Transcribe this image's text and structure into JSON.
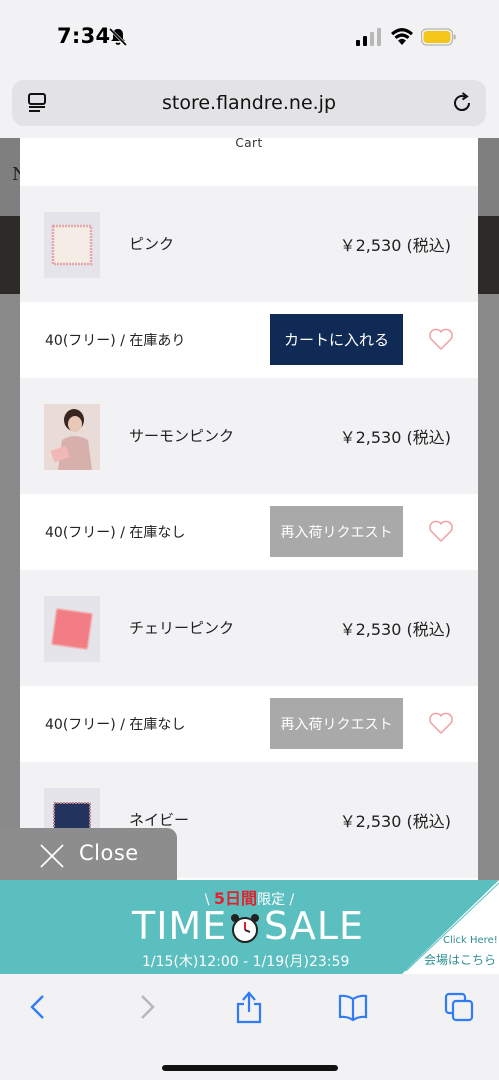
{
  "status_bar": {
    "time": "7:34"
  },
  "browser": {
    "url": "store.flandre.ne.jp"
  },
  "background_page": {
    "letter": "N"
  },
  "modal": {
    "title": "Cart",
    "items": [
      {
        "name": "ピンク",
        "price": "￥2,530 (税込)",
        "stock": "40(フリー) / 在庫あり",
        "button": "カートに入れる",
        "available": true,
        "color": "#f4e6df"
      },
      {
        "name": "サーモンピンク",
        "price": "￥2,530 (税込)",
        "stock": "40(フリー) / 在庫なし",
        "button": "再入荷リクエスト",
        "available": false,
        "color": "#e8c3c0"
      },
      {
        "name": "チェリーピンク",
        "price": "￥2,530 (税込)",
        "stock": "40(フリー) / 在庫なし",
        "button": "再入荷リクエスト",
        "available": false,
        "color": "#f07f86"
      },
      {
        "name": "ネイビー",
        "price": "￥2,530 (税込)",
        "color": "#22345e"
      }
    ]
  },
  "close_tab": {
    "label": "Close"
  },
  "banner": {
    "prefix": "\\",
    "days": "5日間",
    "limited": "限定",
    "suffix": "/",
    "main_left": "TIME",
    "main_right": "SALE",
    "dates": "1/15(木)12:00 - 1/19(月)23:59",
    "click_here": "Click Here!",
    "venue": "会場はこちら"
  },
  "colors": {
    "cart_button": "#102a56",
    "restock_button": "#a9a9a9",
    "heart": "#f0a0a3",
    "banner": "#5bbfc0",
    "ios_blue": "#2f7cf6"
  },
  "icons": [
    "bell-slash-icon",
    "signal-icon",
    "wifi-icon",
    "battery-icon",
    "reader-icon",
    "reload-icon",
    "heart-icon",
    "close-icon",
    "clock-icon",
    "back-icon",
    "forward-icon",
    "share-icon",
    "bookmarks-icon",
    "tabs-icon"
  ]
}
